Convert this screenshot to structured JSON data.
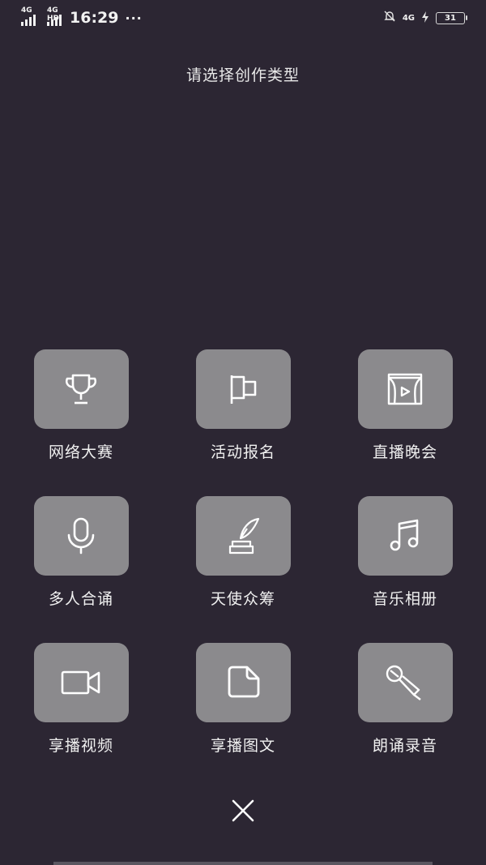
{
  "status_bar": {
    "net1": "4G",
    "net2": "4G HD",
    "time": "16:29",
    "dots": "···",
    "net3": "4G",
    "battery": "31"
  },
  "page": {
    "title": "请选择创作类型"
  },
  "tiles": [
    {
      "label": "网络大赛",
      "icon": "trophy-icon"
    },
    {
      "label": "活动报名",
      "icon": "flag-icon"
    },
    {
      "label": "直播晚会",
      "icon": "stage-play-icon"
    },
    {
      "label": "多人合诵",
      "icon": "microphone-icon"
    },
    {
      "label": "天使众筹",
      "icon": "quill-inkwell-icon"
    },
    {
      "label": "音乐相册",
      "icon": "music-note-icon"
    },
    {
      "label": "享播视频",
      "icon": "video-camera-icon"
    },
    {
      "label": "享播图文",
      "icon": "document-icon"
    },
    {
      "label": "朗诵录音",
      "icon": "handheld-mic-icon"
    }
  ],
  "close": {
    "icon": "close-icon"
  },
  "colors": {
    "background": "#2c2633",
    "tile": "#8b8a8d",
    "text": "#f0f0f0"
  }
}
